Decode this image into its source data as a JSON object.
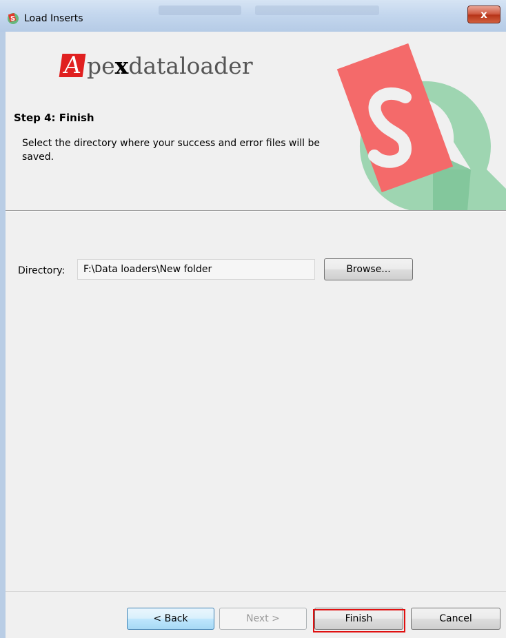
{
  "window": {
    "title": "Load Inserts",
    "close_label": "x"
  },
  "header": {
    "logo_text_prefix": "pe",
    "logo_text_x": "x",
    "logo_text_suffix": "dataloader",
    "logo_letter": "A",
    "step_title": "Step 4: Finish",
    "step_description": "Select the directory where your success and error files will be saved."
  },
  "form": {
    "directory_label": "Directory:",
    "directory_value": "F:\\Data loaders\\New folder",
    "browse_label": "Browse..."
  },
  "footer": {
    "back_label": "< Back",
    "next_label": "Next >",
    "finish_label": "Finish",
    "cancel_label": "Cancel"
  },
  "colors": {
    "logo_red": "#e02020",
    "art_green": "#7fc59a",
    "art_red": "#f26f6f",
    "highlight": "#e01010"
  },
  "icons": {
    "app": "salesforce-apex-loader-icon",
    "close": "close-icon"
  }
}
